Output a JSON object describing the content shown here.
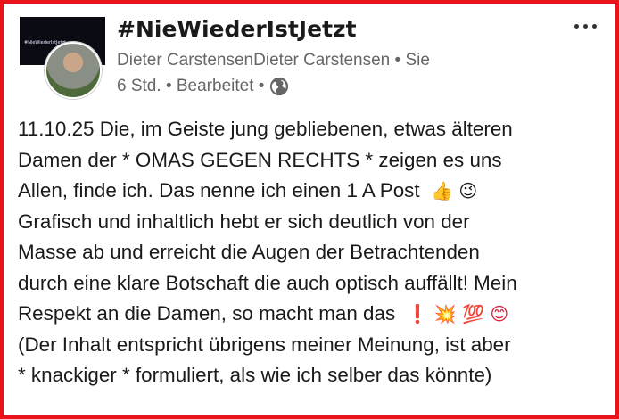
{
  "post": {
    "group_name": "#NieWiederIstJetzt",
    "group_logo_text": "#NieWiederIstJetzt",
    "author_line": "Dieter CarstensenDieter Carstensen • Sie",
    "time": "6 Std.",
    "edited_label": "• Bearbeitet •",
    "visibility_icon": "globe-icon",
    "body_lines": [
      "11.10.25 Die, im Geiste jung gebliebenen, etwas älteren",
      "Damen der * OMAS GEGEN RECHTS * zeigen es uns",
      "Allen, finde ich. Das nenne ich einen 1 A Post",
      "Grafisch und inhaltlich hebt er sich deutlich von der",
      "Masse ab und erreicht die Augen der Betrachtenden",
      "durch eine klare Botschaft die auch optisch auffällt! Mein",
      "Respekt an die Damen, so macht man das",
      "(Der Inhalt entspricht übrigens meiner Meinung, ist aber",
      "* knackiger * formuliert, als wie ich selber das könnte)"
    ],
    "emojis": {
      "line3": "👍 😉",
      "line7": "❗ 💥 💯 😊"
    }
  },
  "colors": {
    "frame": "#e8141a",
    "meta_text": "#666666",
    "body_text": "#1a1a1a"
  }
}
